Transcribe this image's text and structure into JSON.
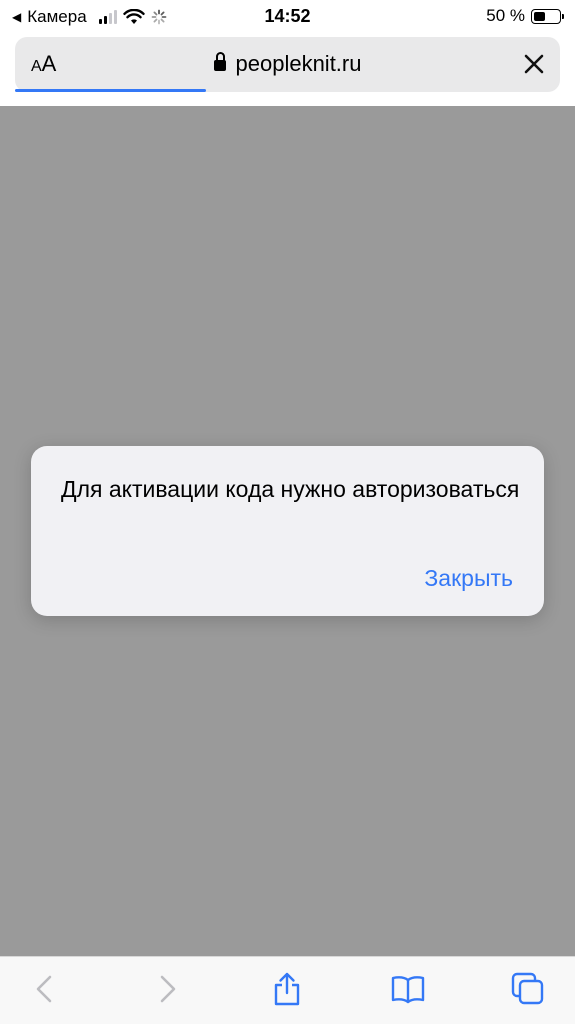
{
  "status_bar": {
    "back_app": "Камера",
    "time": "14:52",
    "battery_percent_label": "50 %",
    "battery_level": 0.5,
    "signal_bars_active": 2,
    "signal_bars_total": 4
  },
  "address_bar": {
    "text_size_label": "AA",
    "url": "peopleknit.ru",
    "load_progress": 0.35
  },
  "alert": {
    "message": "Для активации кода нужно авторизоваться",
    "close_label": "Закрыть"
  },
  "toolbar": {
    "icons": [
      "back-icon",
      "forward-icon",
      "share-icon",
      "bookmarks-icon",
      "tabs-icon"
    ]
  },
  "colors": {
    "accent": "#3478f6",
    "page_overlay": "#9a9a9a",
    "alert_background": "#f1f1f4"
  }
}
